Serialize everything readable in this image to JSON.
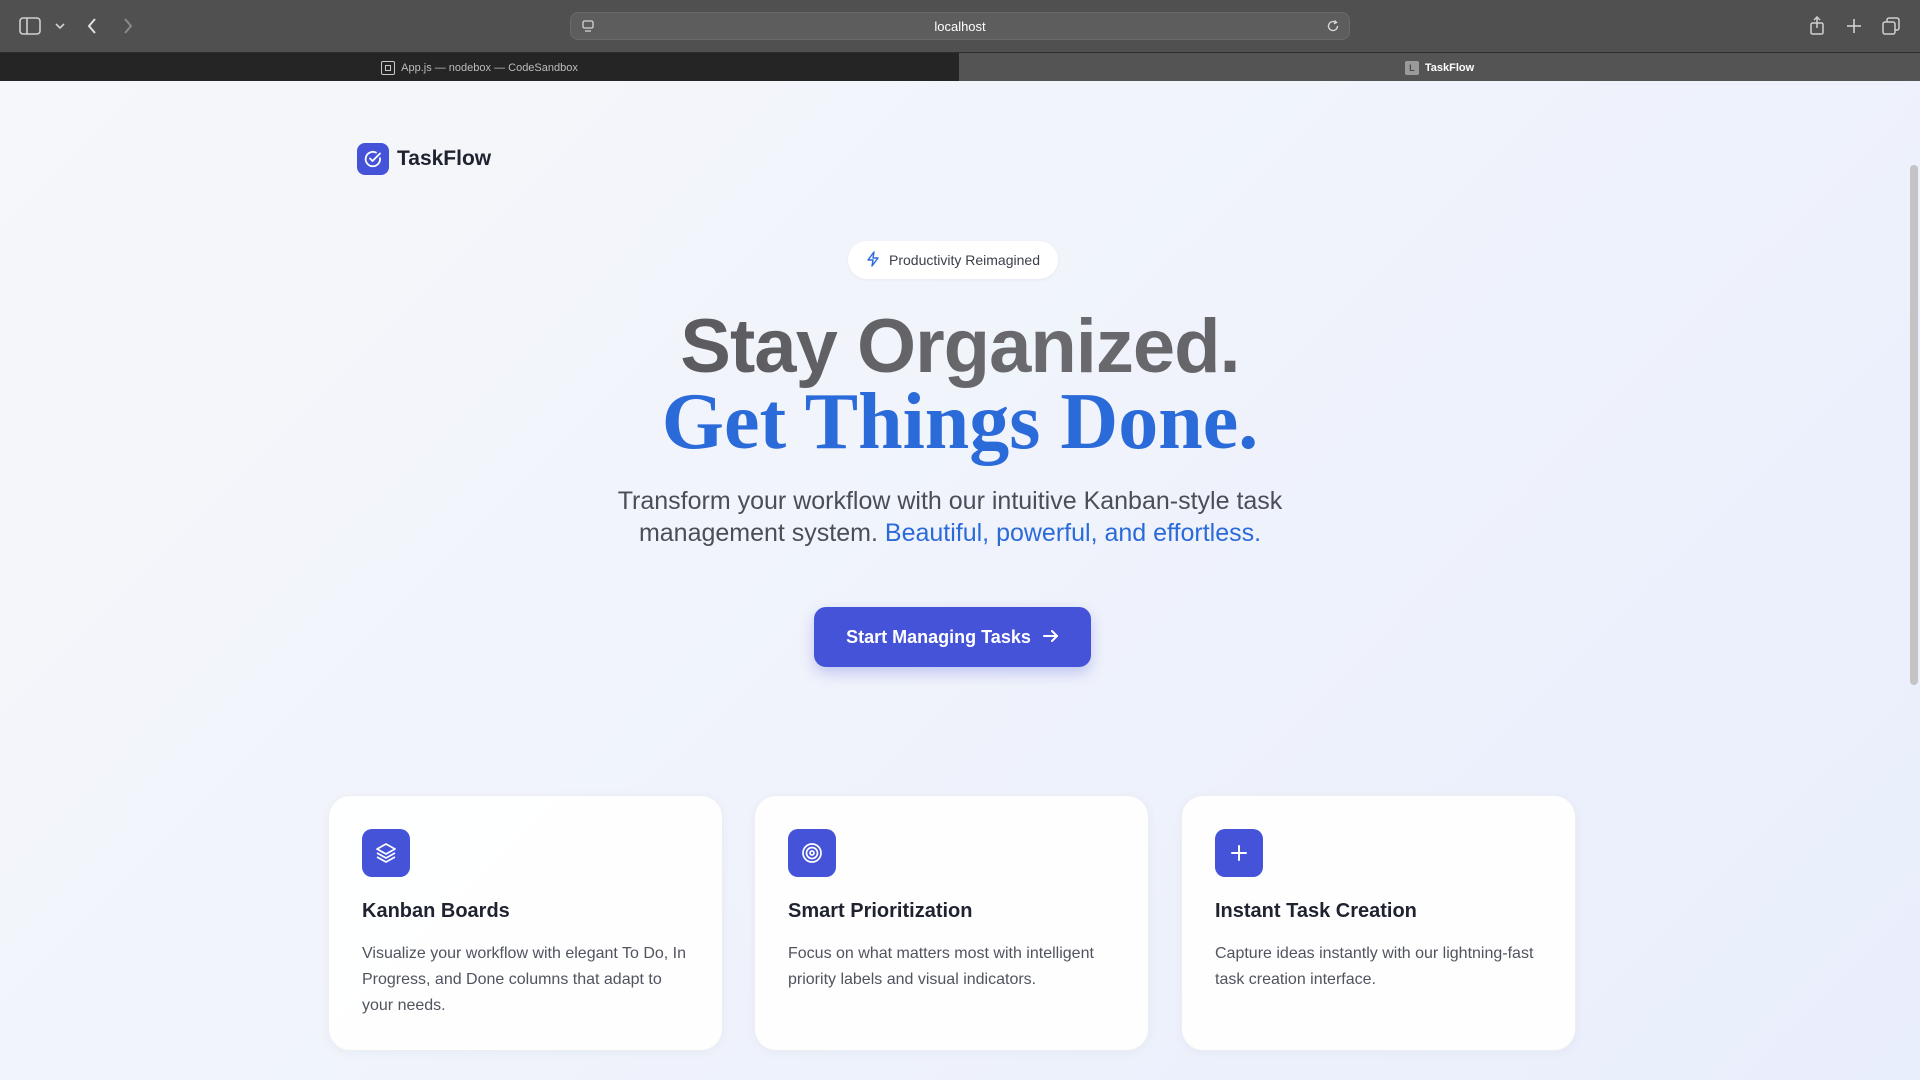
{
  "browser": {
    "url": "localhost",
    "tabs": [
      {
        "label": "App.js — nodebox — CodeSandbox",
        "active": false
      },
      {
        "label": "TaskFlow",
        "active": true,
        "favicon_letter": "L"
      }
    ]
  },
  "page": {
    "brand": "TaskFlow",
    "badge": "Productivity Reimagined",
    "headline_line1": "Stay Organized.",
    "headline_line2": "Get Things Done.",
    "subtitle_main": "Transform your workflow with our intuitive Kanban-style task management system.",
    "subtitle_accent": "Beautiful, powerful, and effortless.",
    "cta_label": "Start Managing Tasks",
    "features": [
      {
        "icon": "layers-icon",
        "title": "Kanban Boards",
        "text": "Visualize your workflow with elegant To Do, In Progress, and Done columns that adapt to your needs."
      },
      {
        "icon": "target-icon",
        "title": "Smart Prioritization",
        "text": "Focus on what matters most with intelligent priority labels and visual indicators."
      },
      {
        "icon": "plus-icon",
        "title": "Instant Task Creation",
        "text": "Capture ideas instantly with our lightning-fast task creation interface."
      }
    ]
  },
  "colors": {
    "primary": "#4553d8",
    "accent_blue": "#2b6ad9",
    "heading_dark": "#3e3e42"
  }
}
